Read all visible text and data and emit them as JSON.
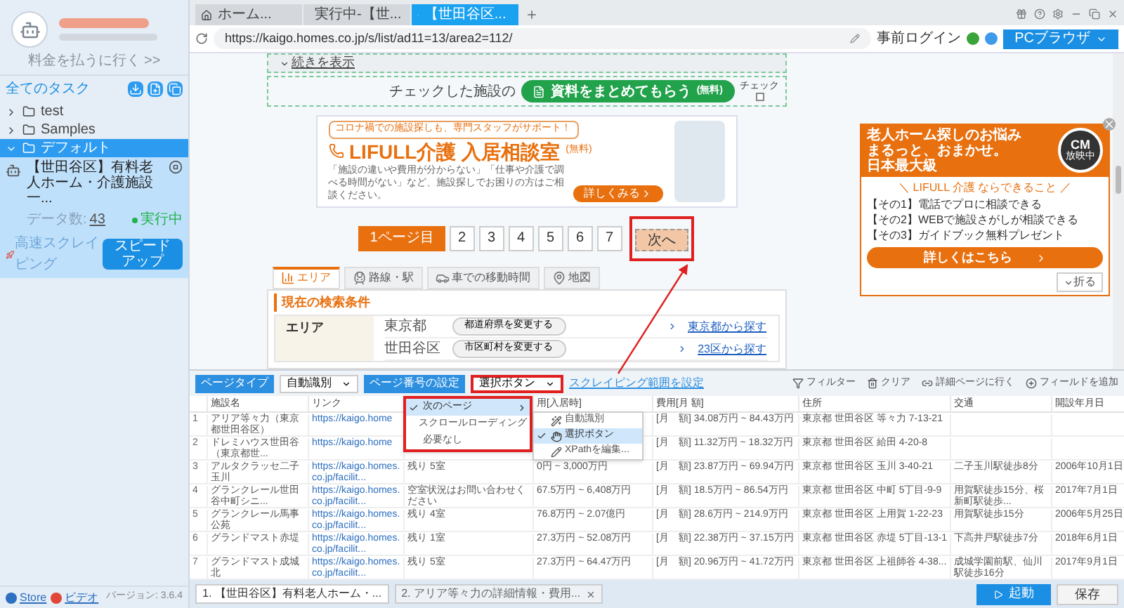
{
  "sidebar": {
    "account_link": "料金を払うに行く >>",
    "tasks_heading": "全てのタスク",
    "folders": [
      {
        "label": "test",
        "expanded": false,
        "selected": false
      },
      {
        "label": "Samples",
        "expanded": false,
        "selected": false
      },
      {
        "label": "デフォルト",
        "expanded": true,
        "selected": true,
        "children": [
          {
            "title": "【世田谷区】有料老人ホーム・介護施設一...",
            "data_count_label": "データ数:",
            "data_count": "43",
            "status": "実行中",
            "mode": "高速スクレイピング",
            "button": "スピードアップ"
          }
        ]
      }
    ],
    "footer_links": [
      {
        "label": "Store",
        "kind": "store"
      },
      {
        "label": "ビデオ",
        "kind": "video"
      }
    ],
    "version": "バージョン: 3.6.4"
  },
  "browser": {
    "tabs": [
      {
        "label": "ホーム...",
        "kind": "home",
        "selected": false
      },
      {
        "label": "実行中-【世...",
        "kind": "page",
        "selected": false
      },
      {
        "label": "【世田谷区...",
        "kind": "page",
        "selected": true
      }
    ],
    "url": "https://kaigo.homes.co.jp/s/list/ad11=13/area2=112/",
    "pre_login": "事前ログイン",
    "mode_button": "PCブラウザ"
  },
  "page": {
    "more_link": "続きを表示",
    "checked_prefix": "チェックした施設の",
    "request_button": "資料をまとめてもらう",
    "request_button_note": "(無料)",
    "check_all": "チェック",
    "check_all_checked": false,
    "banner": {
      "tagline": "コロナ禍での施設探しも、専門スタッフがサポート！",
      "title": "LIFULL介護 入居相談室",
      "title_note": "(無料)",
      "description": "「施設の違いや費用が分からない」「仕事や介護で調べる時間がない」など、施設探しでお困りの方はご相談ください。",
      "button": "詳しくみる"
    },
    "pagination": {
      "pages": [
        {
          "label": "1ページ目",
          "selected": true
        },
        {
          "label": "2",
          "selected": false
        },
        {
          "label": "3",
          "selected": false
        },
        {
          "label": "4",
          "selected": false
        },
        {
          "label": "5",
          "selected": false
        },
        {
          "label": "6",
          "selected": false
        },
        {
          "label": "7",
          "selected": false
        }
      ],
      "next": "次へ"
    },
    "search_tabs": [
      {
        "label": "エリア",
        "kind": "area",
        "selected": true
      },
      {
        "label": "路線・駅",
        "kind": "train",
        "selected": false
      },
      {
        "label": "車での移動時間",
        "kind": "car",
        "selected": false
      },
      {
        "label": "地図",
        "kind": "pin",
        "selected": false
      }
    ],
    "conditions": {
      "heading": "現在の検索条件",
      "label": "エリア",
      "rows": [
        {
          "value": "東京都",
          "button": "都道府県を変更する",
          "link": "東京都から探す"
        },
        {
          "value": "世田谷区",
          "button": "市区町村を変更する",
          "link": "23区から探す"
        }
      ]
    }
  },
  "ad": {
    "headline": [
      "老人ホーム探しのお悩み",
      "まるっと、おまかせ。"
    ],
    "badge": "日本最大級",
    "cm": "CM",
    "cm_note": "放映中",
    "subheading": "＼ LIFULL 介護 ならできること ／",
    "points": [
      "【その1】電話でプロに相談できる",
      "【その2】WEBで施設さがしが相談できる",
      "【その3】ガイドブック無料プレゼント"
    ],
    "button": "詳しくはこちら",
    "collapse": "折る"
  },
  "extractor": {
    "toolbar": {
      "page_type_label": "ページタイプ",
      "page_type_value": "自動識別",
      "pagination_label": "ページ番号の設定",
      "pagination_value": "選択ボタン",
      "scope_link": "スクレイピング範囲を設定",
      "actions": [
        {
          "label": "フィルター",
          "kind": "filter"
        },
        {
          "label": "クリア",
          "kind": "clear"
        },
        {
          "label": "詳細ページに行く",
          "kind": "detail"
        },
        {
          "label": "フィールドを追加",
          "kind": "add"
        }
      ]
    },
    "menu": {
      "items": [
        {
          "label": "次のページ",
          "checked": true,
          "submenu": true
        },
        {
          "label": "スクロールローディング",
          "checked": false,
          "submenu": false
        },
        {
          "label": "必要なし",
          "checked": false,
          "submenu": false
        }
      ],
      "submenu": [
        {
          "label": "自動識別",
          "checked": false,
          "kind": "auto"
        },
        {
          "label": "選択ボタン",
          "checked": true,
          "kind": "click"
        },
        {
          "label": "XPathを編集...",
          "checked": false,
          "kind": "edit"
        }
      ]
    },
    "table": {
      "columns": [
        "施設名",
        "リンク",
        null,
        "用[入居時]",
        "費用[月 額]",
        "住所",
        "交通",
        "開設年月日"
      ],
      "rows": [
        {
          "index": "1",
          "cells": [
            "アリア等々力（東京都世田谷区）",
            "https://kaigo.home",
            null,
            null,
            "[月　額] 34.08万円 ~ 84.43万円",
            "東京都 世田谷区 等々力 7-13-21",
            null,
            null
          ]
        },
        {
          "index": "2",
          "cells": [
            "ドレミハウス世田谷（東京都世...",
            "https://kaigo.home",
            null,
            null,
            "[月　額] 11.32万円 ~ 18.32万円",
            "東京都 世田谷区 給田 4-20-8",
            null,
            null
          ]
        },
        {
          "index": "3",
          "cells": [
            "アルタクラッセ二子玉川",
            "https://kaigo.homes.co.jp/facilit...",
            "残り 5室",
            "0円 ~ 3,000万円",
            "[月　額] 23.87万円 ~ 69.94万円",
            "東京都 世田谷区 玉川 3-40-21",
            "二子玉川駅徒歩8分",
            "2006年10月1日"
          ]
        },
        {
          "index": "4",
          "cells": [
            "グランクレール世田谷中町シニ...",
            "https://kaigo.homes.co.jp/facilit...",
            "空室状況はお問い合わせください",
            "67.5万円 ~ 6,408万円",
            "[月　額] 18.5万円 ~ 86.54万円",
            "東京都 世田谷区 中町 5丁目-9-9",
            "用賀駅徒歩15分、桜新町駅徒歩...",
            "2017年7月1日"
          ]
        },
        {
          "index": "5",
          "cells": [
            "グランクレール馬事公苑",
            "https://kaigo.homes.co.jp/facilit...",
            "残り 4室",
            "76.8万円 ~ 2.07億円",
            "[月　額] 28.6万円 ~ 214.9万円",
            "東京都 世田谷区 上用賀 1-22-23",
            "用賀駅徒歩15分",
            "2006年5月25日"
          ]
        },
        {
          "index": "6",
          "cells": [
            "グランドマスト赤堤",
            "https://kaigo.homes.co.jp/facilit...",
            "残り 1室",
            "27.3万円 ~ 52.08万円",
            "[月　額] 22.38万円 ~ 37.15万円",
            "東京都 世田谷区 赤堤 5丁目-13-1",
            "下高井戸駅徒歩7分",
            "2018年6月1日"
          ]
        },
        {
          "index": "7",
          "cells": [
            "グランドマスト成城北",
            "https://kaigo.homes.co.jp/facilit...",
            "残り 5室",
            "27.3万円 ~ 64.47万円",
            "[月　額] 20.96万円 ~ 41.72万円",
            "東京都 世田谷区 上祖師谷 4-38...",
            "成城学園前駅、仙川駅徒歩16分",
            "2017年9月1日"
          ]
        }
      ]
    },
    "task_tabs": [
      {
        "label": "1. 【世田谷区】有料老人ホーム・...",
        "selected": true
      },
      {
        "label": "2. アリア等々力の詳細情報・費用...",
        "selected": false
      }
    ],
    "start_button": "起動",
    "save_button": "保存"
  }
}
